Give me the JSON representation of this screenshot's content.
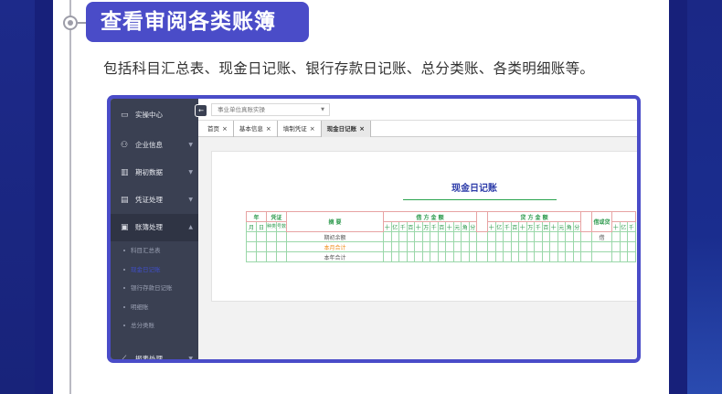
{
  "header": {
    "title": "查看审阅各类账簿",
    "description": "包括科目汇总表、现金日记账、银行存款日记账、总分类账、各类明细账等。"
  },
  "app": {
    "sidebar": {
      "items": [
        {
          "label": "实操中心",
          "icon": "monitor-icon"
        },
        {
          "label": "企业信息",
          "icon": "people-icon"
        },
        {
          "label": "期初数据",
          "icon": "bar-chart-icon"
        },
        {
          "label": "凭证处理",
          "icon": "voucher-icon"
        },
        {
          "label": "账簿处理",
          "icon": "book-icon"
        }
      ],
      "subitems": [
        "科目汇总表",
        "现金日记账",
        "银行存款日记账",
        "明细账",
        "总分类账"
      ],
      "bottom_item": {
        "label": "报表处理",
        "icon": "report-chart-icon"
      }
    },
    "unit_select": {
      "value": "事业单位真账实操"
    },
    "tabs": [
      {
        "label": "首页"
      },
      {
        "label": "基本信息"
      },
      {
        "label": "填制凭证"
      },
      {
        "label": "现金日记账"
      }
    ],
    "ledger": {
      "title": "现金日记账",
      "headers": {
        "year": "年",
        "voucher": "凭证",
        "summary": "摘 要",
        "debit": "借 方 金 额",
        "credit": "贷 方 金 额",
        "dc": "借或贷",
        "month": "月",
        "day": "日",
        "type": "种类",
        "number": "号数"
      },
      "digits": [
        "十",
        "亿",
        "千",
        "百",
        "十",
        "万",
        "千",
        "百",
        "十",
        "元",
        "角",
        "分"
      ],
      "rows": [
        {
          "summary": "期初余额",
          "dc": "借"
        },
        {
          "summary": "本月合计",
          "dc": ""
        },
        {
          "summary": "本年合计",
          "dc": ""
        }
      ]
    }
  }
}
